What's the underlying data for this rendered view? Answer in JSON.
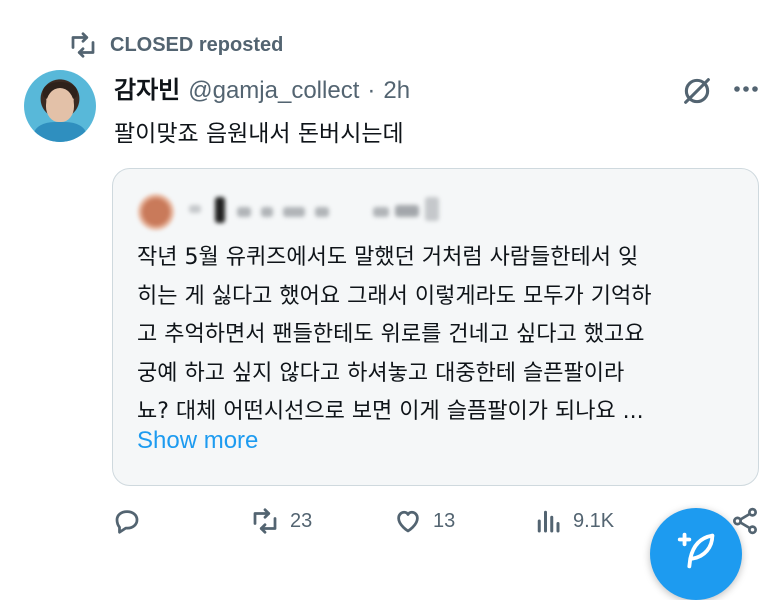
{
  "repost": {
    "label": "CLOSED reposted",
    "icon": "repost-icon"
  },
  "tweet": {
    "author_name": "감자빈",
    "handle": "@gamja_collect",
    "separator": "·",
    "time": "2h",
    "text": "팔이맞죠 음원내서 돈버시는데",
    "icons": [
      "grok-icon",
      "more-icon"
    ]
  },
  "quote": {
    "author_blurred": true,
    "lines": [
      "작년 5월 유퀴즈에서도 말했던 거처럼 사람들한테서 잊",
      "히는 게 싫다고 했어요 그래서 이렇게라도 모두가 기억하",
      "고 추억하면서 팬들한테도 위로를 건네고 싶다고 했고요",
      "궁예 하고 싶지 않다고 하셔놓고 대중한테 슬픈팔이라",
      "뇨? 대체 어떤시선으로 보면 이게 슬픔팔이가 되나요 ..."
    ],
    "show_more": "Show more"
  },
  "actions": {
    "reply": {
      "icon": "reply-icon",
      "count": ""
    },
    "repost": {
      "icon": "repost-icon",
      "count": "23"
    },
    "like": {
      "icon": "heart-icon",
      "count": "13"
    },
    "views": {
      "icon": "views-icon",
      "count": "9.1K"
    },
    "share": {
      "icon": "share-icon"
    }
  },
  "fab": {
    "icon": "compose-icon"
  },
  "colors": {
    "accent": "#1d9bf0",
    "muted": "#536471",
    "text": "#0f1419",
    "quote_bg": "#f5f7f8",
    "border": "#cfd9de"
  }
}
